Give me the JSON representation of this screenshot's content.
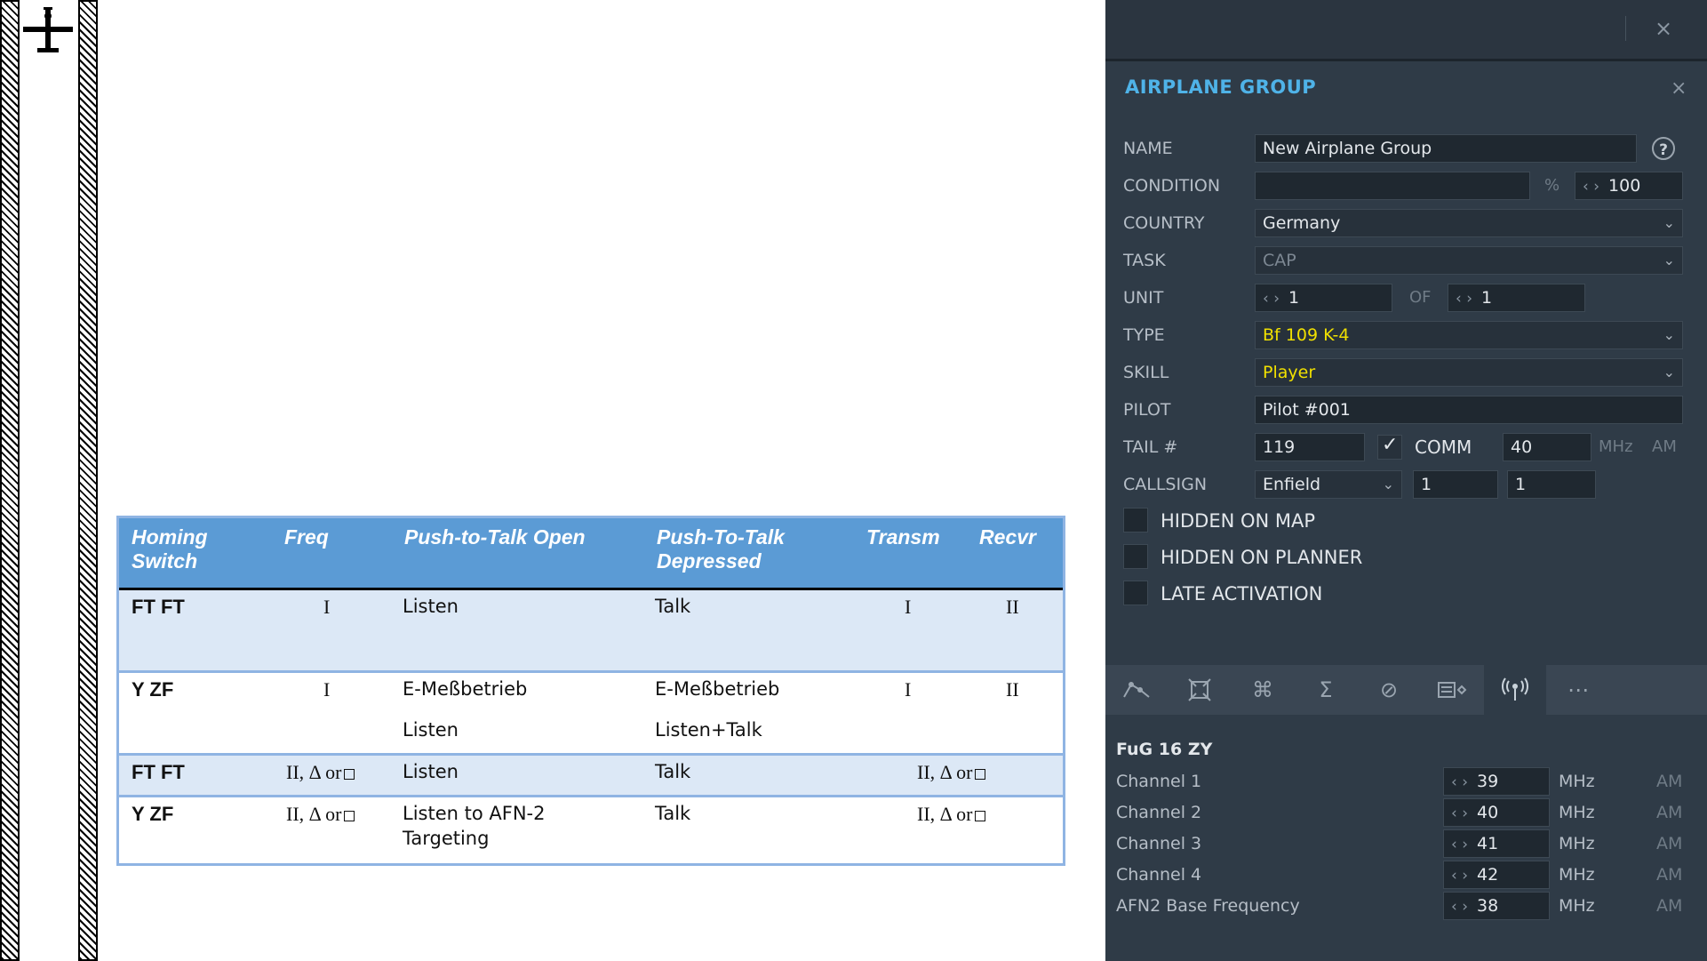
{
  "doc_table": {
    "headers": [
      "Homing Switch",
      "Freq",
      "Push-to-Talk Open",
      "Push-To-Talk Depressed",
      "Transm",
      "Recvr"
    ],
    "header_lines": {
      "homing": [
        "Homing",
        "Switch"
      ],
      "ptt_depressed": [
        "Push-To-Talk",
        "Depressed"
      ]
    },
    "rows": [
      {
        "switch": "FT FT",
        "freq": "I",
        "open": "Listen",
        "open2": "",
        "depressed": "Talk",
        "depressed2": "",
        "transm": "I",
        "recvr": "II"
      },
      {
        "switch": "Y ZF",
        "freq": "I",
        "open": "E-Meßbetrieb",
        "open2": "Listen",
        "depressed": "E-Meßbetrieb",
        "depressed2": "Listen+Talk",
        "transm": "I",
        "recvr": "II"
      },
      {
        "switch": "FT FT",
        "freq": "II, Δ or",
        "open": "Listen",
        "open2": "",
        "depressed": "Talk",
        "depressed2": "",
        "transm_recvr": "II, Δ or"
      },
      {
        "switch": "Y ZF",
        "freq": "II, Δ or",
        "open": "Listen to AFN-2",
        "open2": "Targeting",
        "depressed": "Talk",
        "depressed2": "",
        "transm_recvr": "II, Δ or"
      }
    ]
  },
  "panel": {
    "title": "AIRPLANE GROUP",
    "close_symbol": "×",
    "help_symbol": "?",
    "arrows": "‹ ›",
    "fields": {
      "name": {
        "label": "NAME",
        "value": "New Airplane Group"
      },
      "condition": {
        "label": "CONDITION",
        "value": "",
        "percent_sign": "%",
        "percent": "100"
      },
      "country": {
        "label": "COUNTRY",
        "value": "Germany"
      },
      "task": {
        "label": "TASK",
        "value": "CAP"
      },
      "unit": {
        "label": "UNIT",
        "value": "1",
        "of_label": "OF",
        "of_value": "1"
      },
      "type": {
        "label": "TYPE",
        "value": "Bf 109 K-4"
      },
      "skill": {
        "label": "SKILL",
        "value": "Player"
      },
      "pilot": {
        "label": "PILOT",
        "value": "Pilot #001"
      },
      "tail": {
        "label": "TAIL #",
        "value": "119",
        "comm_label": "COMM",
        "comm_value": "40",
        "mhz": "MHz",
        "am": "AM"
      },
      "callsign": {
        "label": "CALLSIGN",
        "value": "Enfield",
        "num1": "1",
        "num2": "1"
      }
    },
    "checkboxes": [
      {
        "label": "HIDDEN ON MAP",
        "checked": false
      },
      {
        "label": "HIDDEN ON PLANNER",
        "checked": false
      },
      {
        "label": "LATE ACTIVATION",
        "checked": false
      }
    ],
    "toolbar_icons": [
      "route-icon",
      "target-icon",
      "command-icon",
      "sum-icon",
      "prohibit-icon",
      "payload-icon",
      "radio-icon",
      "more-icon"
    ],
    "radio": {
      "title": "FuG 16 ZY",
      "channels": [
        {
          "label": "Channel 1",
          "value": "39",
          "unit": "MHz",
          "mod": "AM"
        },
        {
          "label": "Channel 2",
          "value": "40",
          "unit": "MHz",
          "mod": "AM"
        },
        {
          "label": "Channel 3",
          "value": "41",
          "unit": "MHz",
          "mod": "AM"
        },
        {
          "label": "Channel 4",
          "value": "42",
          "unit": "MHz",
          "mod": "AM"
        },
        {
          "label": "AFN2 Base Frequency",
          "value": "38",
          "unit": "MHz",
          "mod": "AM"
        }
      ]
    }
  }
}
